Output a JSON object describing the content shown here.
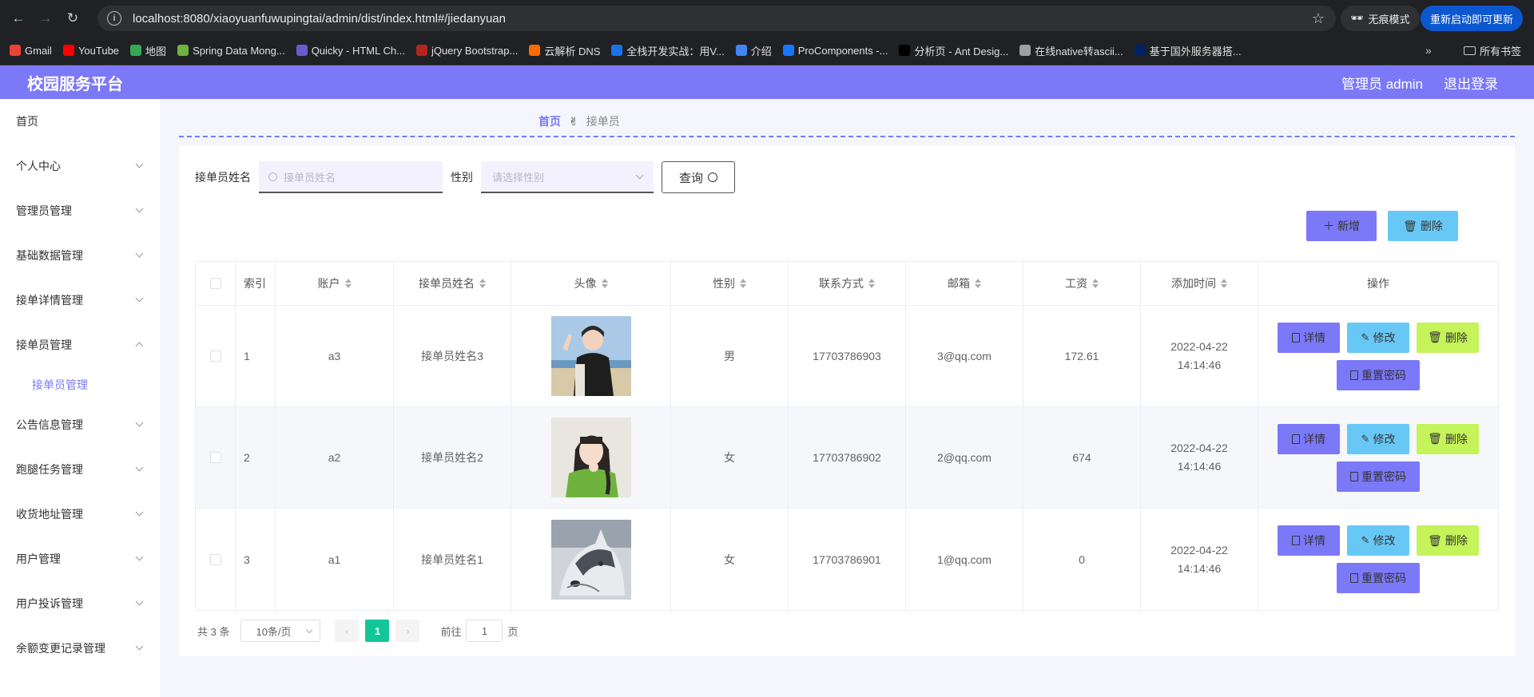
{
  "browser": {
    "url": "localhost:8080/xiaoyuanfuwupingtai/admin/dist/index.html#/jiedanyuan",
    "incognito_label": "无痕模式",
    "restart_label": "重新启动即可更新",
    "bookmarks": [
      {
        "label": "Gmail",
        "color": "#ea4335"
      },
      {
        "label": "YouTube",
        "color": "#ff0000"
      },
      {
        "label": "地图",
        "color": "#34a853"
      },
      {
        "label": "Spring Data Mong...",
        "color": "#6db33f"
      },
      {
        "label": "Quicky - HTML Ch...",
        "color": "#6a5acd"
      },
      {
        "label": "jQuery Bootstrap...",
        "color": "#b3261e"
      },
      {
        "label": "云解析 DNS",
        "color": "#ff6a00"
      },
      {
        "label": "全栈开发实战：用V...",
        "color": "#1a73e8"
      },
      {
        "label": "介绍",
        "color": "#4285f4"
      },
      {
        "label": "ProComponents -...",
        "color": "#1677ff"
      },
      {
        "label": "分析页 - Ant Desig...",
        "color": "#000000"
      },
      {
        "label": "在线native转ascii...",
        "color": "#9aa0a6"
      },
      {
        "label": "基于国外服务器搭...",
        "color": "#012169"
      }
    ],
    "all_bookmarks_label": "所有书签"
  },
  "header": {
    "title": "校园服务平台",
    "user_label": "管理员 admin",
    "logout_label": "退出登录",
    "accent": "#7b79f8"
  },
  "sidebar": {
    "items": [
      {
        "label": "首页",
        "has_arrow": false
      },
      {
        "label": "个人中心",
        "has_arrow": true
      },
      {
        "label": "管理员管理",
        "has_arrow": true
      },
      {
        "label": "基础数据管理",
        "has_arrow": true
      },
      {
        "label": "接单详情管理",
        "has_arrow": true
      },
      {
        "label": "接单员管理",
        "has_arrow": true,
        "expanded": true
      },
      {
        "label": "公告信息管理",
        "has_arrow": true
      },
      {
        "label": "跑腿任务管理",
        "has_arrow": true
      },
      {
        "label": "收货地址管理",
        "has_arrow": true
      },
      {
        "label": "用户管理",
        "has_arrow": true
      },
      {
        "label": "用户投诉管理",
        "has_arrow": true
      },
      {
        "label": "余额变更记录管理",
        "has_arrow": true
      }
    ],
    "sub_item": "接单员管理"
  },
  "breadcrumb": {
    "home": "首页",
    "separator": "✌",
    "current": "接单员"
  },
  "search": {
    "name_label": "接单员姓名",
    "name_placeholder": "接单员姓名",
    "gender_label": "性别",
    "gender_placeholder": "请选择性别",
    "query_label": "查询"
  },
  "actions": {
    "add_label": "新增",
    "delete_label": "删除"
  },
  "table": {
    "headers": {
      "index": "索引",
      "account": "账户",
      "name": "接单员姓名",
      "avatar": "头像",
      "gender": "性别",
      "phone": "联系方式",
      "email": "邮箱",
      "salary": "工资",
      "added_time": "添加时间",
      "ops": "操作"
    },
    "rows": [
      {
        "index": "1",
        "account": "a3",
        "name": "接单员姓名3",
        "avatar": "photo-person-jacket",
        "gender": "男",
        "phone": "17703786903",
        "email": "3@qq.com",
        "salary": "172.61",
        "added_time": "2022-04-22 14:14:46"
      },
      {
        "index": "2",
        "account": "a2",
        "name": "接单员姓名2",
        "avatar": "photo-person-green-sweater",
        "gender": "女",
        "phone": "17703786902",
        "email": "2@qq.com",
        "salary": "674",
        "added_time": "2022-04-22 14:14:46"
      },
      {
        "index": "3",
        "account": "a1",
        "name": "接单员姓名1",
        "avatar": "photo-husky-dog",
        "gender": "女",
        "phone": "17703786901",
        "email": "1@qq.com",
        "salary": "0",
        "added_time": "2022-04-22 14:14:46"
      }
    ],
    "op_labels": {
      "detail": "详情",
      "edit": "修改",
      "delete": "删除",
      "reset": "重置密码"
    }
  },
  "pagination": {
    "total_label": "共 3 条",
    "page_size": "10条/页",
    "current_page": "1",
    "goto_label": "前往",
    "goto_value": "1",
    "page_unit": "页"
  }
}
